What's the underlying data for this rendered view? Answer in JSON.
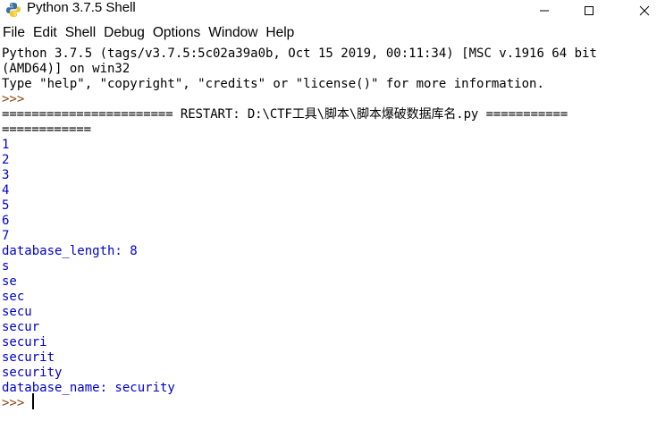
{
  "window": {
    "title": "Python 3.7.5 Shell",
    "min_icon": "minimize-icon",
    "max_icon": "maximize-icon",
    "close_icon": "close-icon",
    "app_icon": "python-icon"
  },
  "menu": {
    "items": [
      "File",
      "Edit",
      "Shell",
      "Debug",
      "Options",
      "Window",
      "Help"
    ]
  },
  "shell": {
    "banner_line1": "Python 3.7.5 (tags/v3.7.5:5c02a39a0b, Oct 15 2019, 00:11:34) [MSC v.1916 64 bit",
    "banner_line2": "(AMD64)] on win32",
    "banner_line3": "Type \"help\", \"copyright\", \"credits\" or \"license()\" for more information.",
    "prompt1": ">>>",
    "restart_line1": "======================= RESTART: D:\\CTF工具\\脚本\\脚本爆破数据库名.py ===========",
    "restart_line2": "============",
    "output": [
      "1",
      "2",
      "3",
      "4",
      "5",
      "6",
      "7",
      "database_length: 8",
      "s",
      "se",
      "sec",
      "secu",
      "secur",
      "securi",
      "securit",
      "security",
      "database_name: security"
    ],
    "prompt2": ">>> "
  },
  "colors": {
    "output_blue": "#0000cc",
    "prompt_brown": "#8b4513",
    "text_black": "#000000"
  }
}
